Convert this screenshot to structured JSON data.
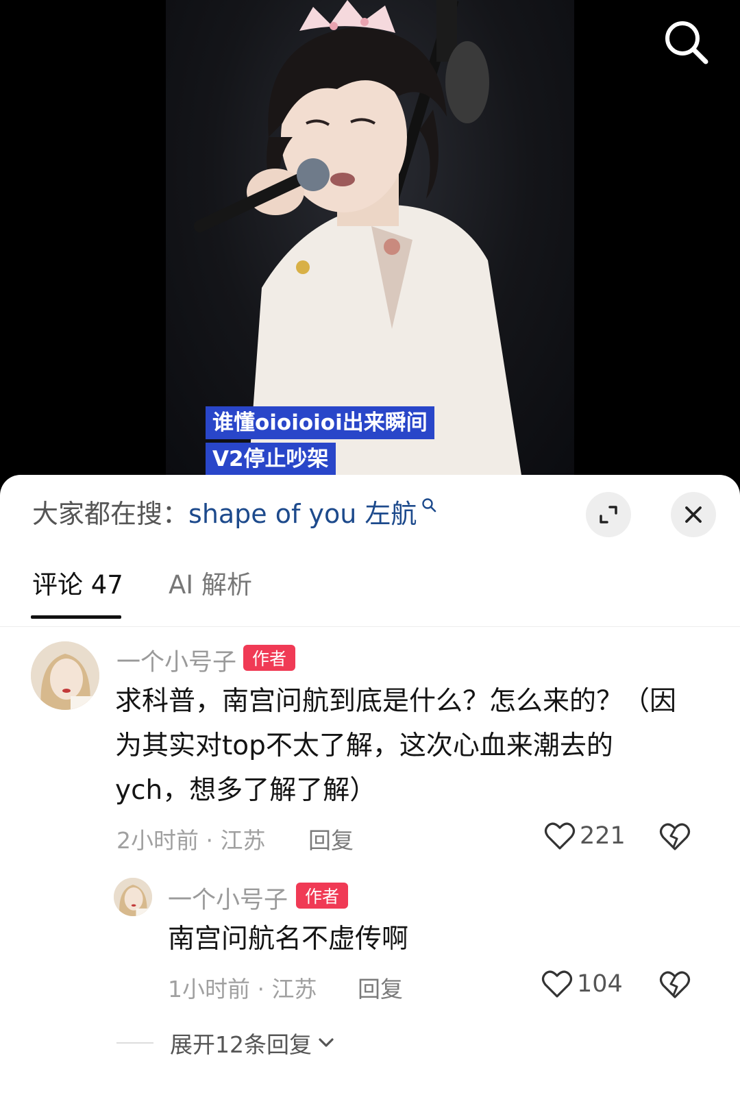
{
  "video": {
    "subtitle_line1": "谁懂oioioioi出来瞬间",
    "subtitle_line2": "V2停止吵架",
    "subtitle_bg": "#2946c9"
  },
  "search_hint": {
    "prefix": "大家都在搜：",
    "term": "shape of you 左航",
    "icon": "search-icon"
  },
  "tabs": [
    {
      "label": "评论 47",
      "active": true
    },
    {
      "label": "AI 解析",
      "active": false
    }
  ],
  "comment": {
    "username": "一个小号子",
    "badge": "作者",
    "text": "求科普，南宫问航到底是什么？怎么来的？（因为其实对top不太了解，这次心血来潮去的ych，想多了解了解）",
    "time_location": "2小时前 · 江苏",
    "reply_label": "回复",
    "likes": "221"
  },
  "reply": {
    "username": "一个小号子",
    "badge": "作者",
    "text": "南宫问航名不虚传啊",
    "time_location": "1小时前 · 江苏",
    "reply_label": "回复",
    "likes": "104"
  },
  "expand_replies": "展开12条回复",
  "colors": {
    "badge": "#f03a55",
    "search_term": "#1d4a8c"
  }
}
